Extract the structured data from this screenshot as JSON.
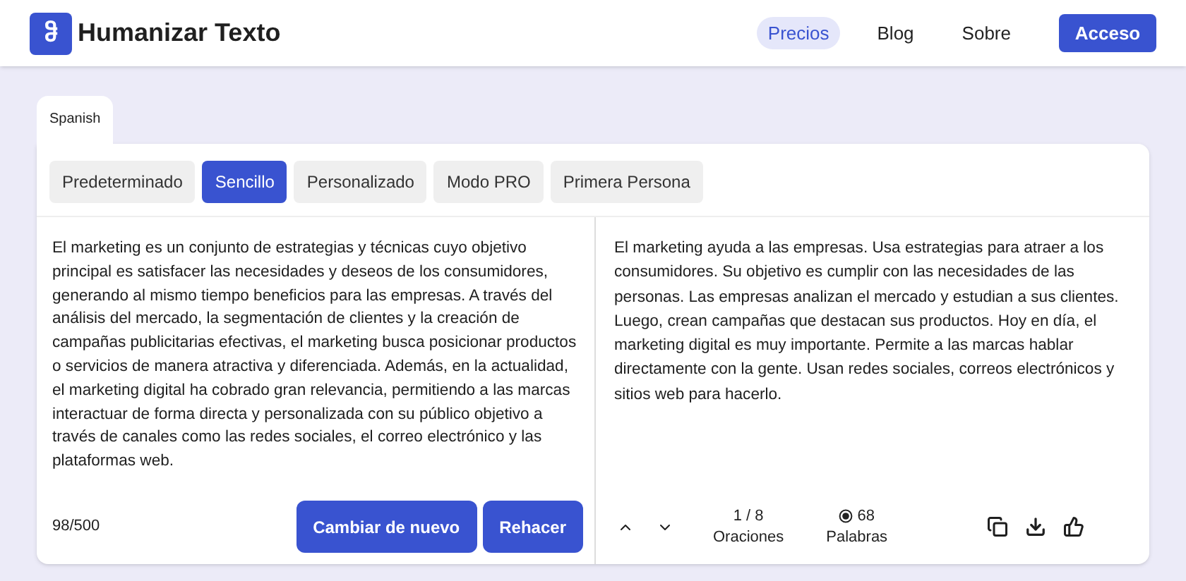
{
  "brand": {
    "logo": "ჵ",
    "name": "Humanizar Texto"
  },
  "nav": [
    {
      "label": "Precios",
      "selected": true
    },
    {
      "label": "Blog",
      "selected": false
    },
    {
      "label": "Sobre",
      "selected": false
    }
  ],
  "login": "Acceso",
  "language_tab": "Spanish",
  "modes": [
    {
      "label": "Predeterminado",
      "selected": false
    },
    {
      "label": "Sencillo",
      "selected": true
    },
    {
      "label": "Personalizado",
      "selected": false
    },
    {
      "label": "Modo PRO",
      "selected": false
    },
    {
      "label": "Primera Persona",
      "selected": false
    }
  ],
  "input": {
    "text": "El marketing es un conjunto de estrategias y técnicas cuyo objetivo principal es satisfacer las necesidades y deseos de los consumidores, generando al mismo tiempo beneficios para las empresas. A través del análisis del mercado, la segmentación de clientes y la creación de campañas publicitarias efectivas, el marketing busca posicionar productos o servicios de manera atractiva y diferenciada. Además, en la actualidad, el marketing digital ha cobrado gran relevancia, permitiendo a las marcas interactuar de forma directa y personalizada con su público objetivo a través de canales como las redes sociales, el correo electrónico y las plataformas web.",
    "counter": "98/500",
    "buttons": [
      "Cambiar de nuevo",
      "Rehacer"
    ]
  },
  "output": {
    "text": "El marketing ayuda a las empresas. Usa estrategias para atraer a los consumidores. Su objetivo es cumplir con las necesidades de las personas. Las empresas analizan el mercado y estudian a sus clientes. Luego, crean campañas que destacan sus productos. Hoy en día, el marketing digital es muy importante. Permite a las marcas hablar directamente con la gente. Usan redes sociales, correos electrónicos y sitios web para hacerlo.",
    "sentences": {
      "value": "1 / 8",
      "label": "Oraciones"
    },
    "words": {
      "value": "68",
      "label": "Palabras"
    }
  }
}
